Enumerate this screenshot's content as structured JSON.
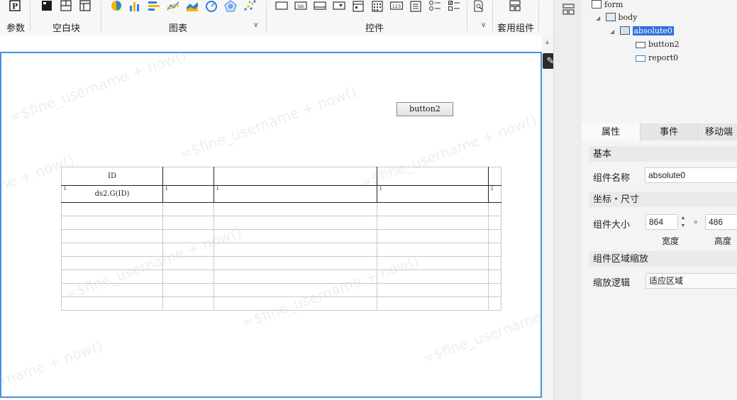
{
  "toolbar": {
    "groups": [
      {
        "label": "参数"
      },
      {
        "label": "空白块"
      },
      {
        "label": "图表"
      },
      {
        "label": "控件"
      },
      {
        "label": "套用组件"
      }
    ],
    "param_icon_text": "P",
    "widget_icons_text": [
      "lab",
      "123"
    ],
    "icons": {
      "param": "parameter-icon",
      "blank": [
        "blank-block-icon",
        "layout-split-icon",
        "layout-grid-icon"
      ],
      "charts": [
        "pie-chart-icon",
        "bar-chart-icon",
        "hbar-chart-icon",
        "line-chart-icon",
        "area-chart-icon",
        "gauge-chart-icon",
        "radar-chart-icon",
        "scatter-chart-icon"
      ],
      "widgets": [
        "text-field-icon",
        "label-icon",
        "button-icon",
        "combo-box-icon",
        "date-icon",
        "calendar-icon",
        "number-icon",
        "list-icon",
        "radio-group-icon",
        "checkbox-group-icon",
        "preview-icon"
      ],
      "template": "template-component-icon"
    }
  },
  "canvas": {
    "watermark_text": "=$fine_username + now()",
    "button": {
      "label": "button2"
    },
    "report": {
      "header": [
        "ID",
        "",
        "",
        "",
        ""
      ],
      "data_row": [
        "ds2.G(ID)",
        "",
        "",
        "",
        ""
      ],
      "empty_rows": 8
    }
  },
  "tree": {
    "nodes": [
      {
        "label": "form",
        "level": 0
      },
      {
        "label": "body",
        "level": 1
      },
      {
        "label": "absolute0",
        "level": 2,
        "selected": true
      },
      {
        "label": "button2",
        "level": 3
      },
      {
        "label": "report0",
        "level": 3
      }
    ]
  },
  "props": {
    "tabs": [
      "属性",
      "事件",
      "移动端"
    ],
    "sections": {
      "basic": "基本",
      "coords": "坐标・尺寸",
      "scale": "组件区域缩放"
    },
    "name_label": "组件名称",
    "name_value": "absolute0",
    "size_label": "组件大小",
    "width_value": "864",
    "height_value": "486",
    "width_label": "宽度",
    "height_label": "高度",
    "scale_label": "缩放逻辑",
    "scale_value": "适应区域"
  },
  "colors": {
    "selection": "#2f6fe0",
    "frame": "#4a90e2"
  }
}
